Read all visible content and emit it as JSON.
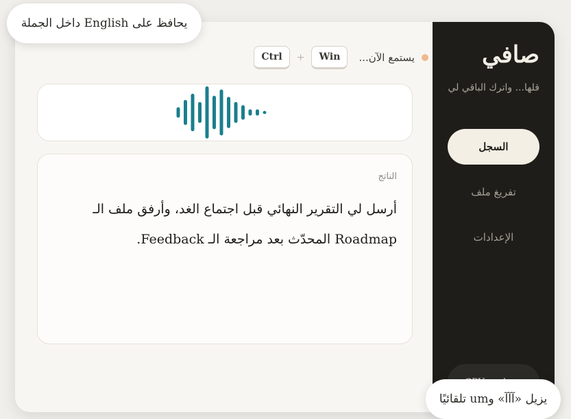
{
  "app": {
    "title": "صافي",
    "tagline": "قلها... واترك الباقي لي"
  },
  "nav": [
    {
      "label": "السجل",
      "active": true
    },
    {
      "label": "تفريغ ملف",
      "active": false
    },
    {
      "label": "الإعدادات",
      "active": false
    }
  ],
  "gpu_status": "جاهز · GPU",
  "status": {
    "text": "يستمع الآن...",
    "keys": [
      "Win",
      "Ctrl"
    ],
    "separator": "+"
  },
  "waveform": {
    "color": "#1a7f8c",
    "levels": [
      0.2,
      0.48,
      0.72,
      0.4,
      1.0,
      0.64,
      0.88,
      0.6,
      0.4,
      0.28,
      0.12,
      0.12,
      0.06
    ]
  },
  "result": {
    "label": "الناتج",
    "text": "أرسل لي التقرير النهائي قبل اجتماع الغد، وأرفق ملف الـ Roadmap المحدّث بعد مراجعة الـ Feedback."
  },
  "toasts": {
    "top": "يحافظ على English داخل الجملة",
    "bottom": "يزيل «آآآ» وum تلقائيًا"
  }
}
